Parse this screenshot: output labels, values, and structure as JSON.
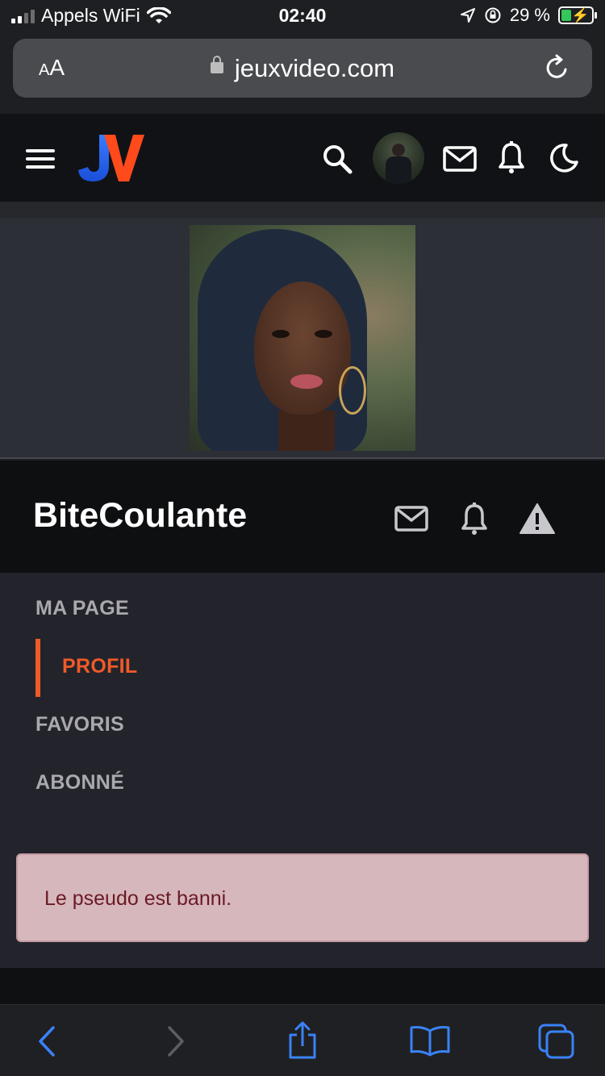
{
  "status_bar": {
    "carrier": "Appels WiFi",
    "time": "02:40",
    "battery_percent": "29 %"
  },
  "browser": {
    "text_size_label_small": "A",
    "text_size_label_large": "A",
    "url_host": "jeuxvideo.com"
  },
  "site_header": {
    "logo_text": "JV",
    "icons": [
      "menu-icon",
      "search-icon",
      "avatar",
      "mail-icon",
      "bell-icon",
      "moon-icon"
    ]
  },
  "profile": {
    "username": "BiteCoulante",
    "actions": [
      "mail-icon",
      "bell-icon",
      "warning-icon"
    ]
  },
  "nav": {
    "items": [
      {
        "label": "MA PAGE"
      },
      {
        "label": "PROFIL"
      },
      {
        "label": "FAVORIS"
      },
      {
        "label": "ABONNÉ"
      }
    ],
    "active_index": 1
  },
  "alert": {
    "message": "Le pseudo est banni."
  },
  "toolbar": {
    "icons": [
      "back-icon",
      "forward-icon",
      "share-icon",
      "bookmarks-icon",
      "tabs-icon"
    ]
  },
  "colors": {
    "accent": "#f05a28",
    "alert_bg": "#d6b7bc",
    "alert_text": "#6b1a24",
    "toolbar_blue": "#3a82f7"
  }
}
